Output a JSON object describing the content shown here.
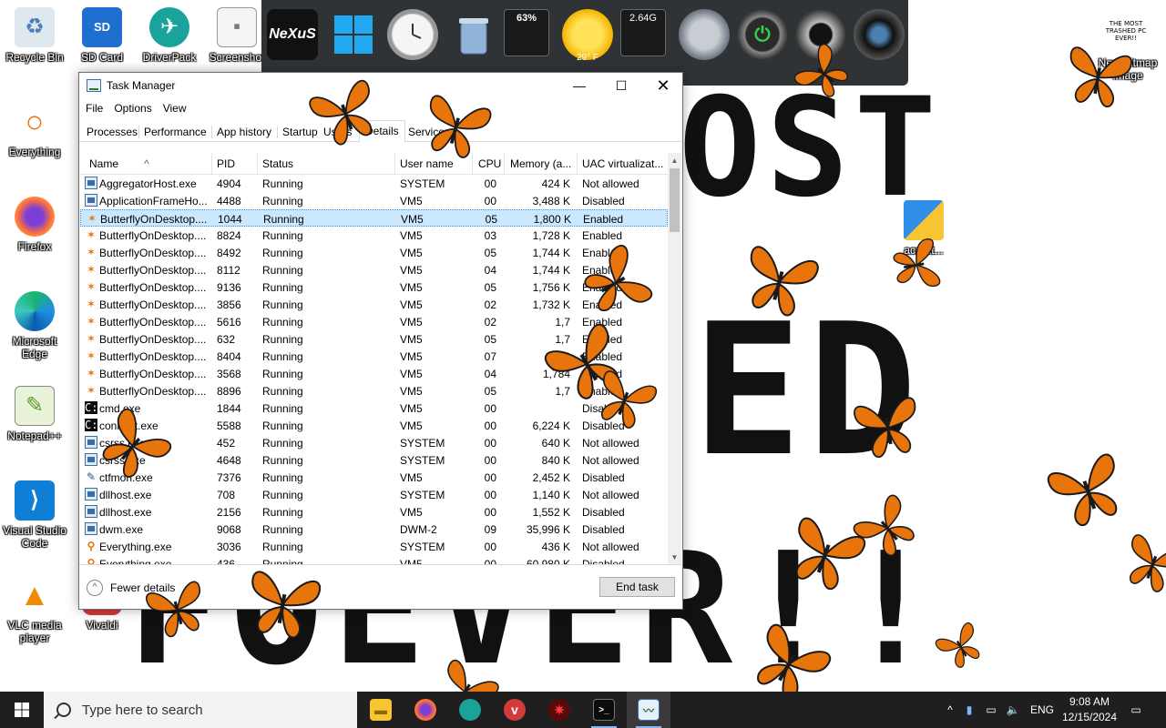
{
  "wallpaper": {
    "big_text_1": "OST",
    "big_text_2": "ED",
    "big_text_3": "FOEVER!!",
    "logo_text": "THE MOST TRASHED PC EVER!!"
  },
  "desktop_icons": [
    {
      "label": "Recycle Bin",
      "icon": "recycle-bin-icon"
    },
    {
      "label": "SD Card",
      "icon": "sd-card-icon"
    },
    {
      "label": "DriverPack",
      "icon": "driverpack-icon"
    },
    {
      "label": "Screenshot",
      "icon": "screenshot-icon"
    },
    {
      "label": "Everything",
      "icon": "everything-search-icon"
    },
    {
      "label": "Firefox",
      "icon": "firefox-icon"
    },
    {
      "label": "Microsoft Edge",
      "icon": "edge-icon"
    },
    {
      "label": "Notepad++",
      "icon": "notepadpp-icon"
    },
    {
      "label": "Visual Studio Code",
      "icon": "vscode-icon"
    },
    {
      "label": "VLC media player",
      "icon": "vlc-icon"
    },
    {
      "label": "Vivaldi",
      "icon": "vivaldi-icon"
    },
    {
      "label": "New Bitmap Image",
      "icon": "bitmap-icon"
    },
    {
      "label": "acreat...",
      "icon": "installer-shield-icon"
    }
  ],
  "dock": {
    "nexus_label": "NeXuS",
    "cpu_percent": "63%",
    "weather_temp": "29° F",
    "ram_label": "2.64G"
  },
  "taskmanager": {
    "title": "Task Manager",
    "menu": [
      "File",
      "Options",
      "View"
    ],
    "tabs": [
      "Processes",
      "Performance",
      "App history",
      "Startup",
      "Users",
      "Details",
      "Services"
    ],
    "active_tab": "Details",
    "columns": [
      "Name",
      "PID",
      "Status",
      "User name",
      "CPU",
      "Memory (a...",
      "UAC virtualizat..."
    ],
    "rows": [
      {
        "icon": "exe",
        "name": "AggregatorHost.exe",
        "pid": "4904",
        "status": "Running",
        "user": "SYSTEM",
        "cpu": "00",
        "mem": "424 K",
        "uac": "Not allowed"
      },
      {
        "icon": "exe",
        "name": "ApplicationFrameHo...",
        "pid": "4488",
        "status": "Running",
        "user": "VM5",
        "cpu": "00",
        "mem": "3,488 K",
        "uac": "Disabled"
      },
      {
        "icon": "bfly",
        "name": "ButterflyOnDesktop....",
        "pid": "1044",
        "status": "Running",
        "user": "VM5",
        "cpu": "05",
        "mem": "1,800 K",
        "uac": "Enabled",
        "selected": true
      },
      {
        "icon": "bfly",
        "name": "ButterflyOnDesktop....",
        "pid": "8824",
        "status": "Running",
        "user": "VM5",
        "cpu": "03",
        "mem": "1,728 K",
        "uac": "Enabled"
      },
      {
        "icon": "bfly",
        "name": "ButterflyOnDesktop....",
        "pid": "8492",
        "status": "Running",
        "user": "VM5",
        "cpu": "05",
        "mem": "1,744 K",
        "uac": "Enabled"
      },
      {
        "icon": "bfly",
        "name": "ButterflyOnDesktop....",
        "pid": "8112",
        "status": "Running",
        "user": "VM5",
        "cpu": "04",
        "mem": "1,744 K",
        "uac": "Enabled"
      },
      {
        "icon": "bfly",
        "name": "ButterflyOnDesktop....",
        "pid": "9136",
        "status": "Running",
        "user": "VM5",
        "cpu": "05",
        "mem": "1,756 K",
        "uac": "Enabled"
      },
      {
        "icon": "bfly",
        "name": "ButterflyOnDesktop....",
        "pid": "3856",
        "status": "Running",
        "user": "VM5",
        "cpu": "02",
        "mem": "1,732 K",
        "uac": "Enabled"
      },
      {
        "icon": "bfly",
        "name": "ButterflyOnDesktop....",
        "pid": "5616",
        "status": "Running",
        "user": "VM5",
        "cpu": "02",
        "mem": "1,7",
        "uac": "Enabled"
      },
      {
        "icon": "bfly",
        "name": "ButterflyOnDesktop....",
        "pid": "632",
        "status": "Running",
        "user": "VM5",
        "cpu": "05",
        "mem": "1,7",
        "uac": "Enabled"
      },
      {
        "icon": "bfly",
        "name": "ButterflyOnDesktop....",
        "pid": "8404",
        "status": "Running",
        "user": "VM5",
        "cpu": "07",
        "mem": "1,72",
        "uac": "Enabled"
      },
      {
        "icon": "bfly",
        "name": "ButterflyOnDesktop....",
        "pid": "3568",
        "status": "Running",
        "user": "VM5",
        "cpu": "04",
        "mem": "1,784",
        "uac": "Enabled"
      },
      {
        "icon": "bfly",
        "name": "ButterflyOnDesktop....",
        "pid": "8896",
        "status": "Running",
        "user": "VM5",
        "cpu": "05",
        "mem": "1,7",
        "uac": "Enabled"
      },
      {
        "icon": "cmd",
        "name": "cmd.exe",
        "pid": "1844",
        "status": "Running",
        "user": "VM5",
        "cpu": "00",
        "mem": "",
        "uac": "Disabled"
      },
      {
        "icon": "cmd",
        "name": "conhost.exe",
        "pid": "5588",
        "status": "Running",
        "user": "VM5",
        "cpu": "00",
        "mem": "6,224 K",
        "uac": "Disabled"
      },
      {
        "icon": "exe",
        "name": "csrss.exe",
        "pid": "452",
        "status": "Running",
        "user": "SYSTEM",
        "cpu": "00",
        "mem": "640 K",
        "uac": "Not allowed"
      },
      {
        "icon": "exe",
        "name": "csrss.exe",
        "pid": "4648",
        "status": "Running",
        "user": "SYSTEM",
        "cpu": "00",
        "mem": "840 K",
        "uac": "Not allowed"
      },
      {
        "icon": "pen",
        "name": "ctfmon.exe",
        "pid": "7376",
        "status": "Running",
        "user": "VM5",
        "cpu": "00",
        "mem": "2,452 K",
        "uac": "Disabled"
      },
      {
        "icon": "exe",
        "name": "dllhost.exe",
        "pid": "708",
        "status": "Running",
        "user": "SYSTEM",
        "cpu": "00",
        "mem": "1,140 K",
        "uac": "Not allowed"
      },
      {
        "icon": "exe",
        "name": "dllhost.exe",
        "pid": "2156",
        "status": "Running",
        "user": "VM5",
        "cpu": "00",
        "mem": "1,552 K",
        "uac": "Disabled"
      },
      {
        "icon": "exe",
        "name": "dwm.exe",
        "pid": "9068",
        "status": "Running",
        "user": "DWM-2",
        "cpu": "09",
        "mem": "35,996 K",
        "uac": "Disabled"
      },
      {
        "icon": "search",
        "name": "Everything.exe",
        "pid": "3036",
        "status": "Running",
        "user": "SYSTEM",
        "cpu": "00",
        "mem": "436 K",
        "uac": "Not allowed"
      },
      {
        "icon": "search",
        "name": "Everything.exe",
        "pid": "436",
        "status": "Running",
        "user": "VM5",
        "cpu": "00",
        "mem": "60,980 K",
        "uac": "Disabled"
      }
    ],
    "fewer_details": "Fewer details",
    "end_task": "End task"
  },
  "taskbar": {
    "search_placeholder": "Type here to search",
    "language": "ENG",
    "time": "9:08 AM",
    "date": "12/15/2024"
  },
  "colors": {
    "selection": "#cce8ff",
    "taskbar": "#1f1f1f",
    "butterfly": "#e8740c",
    "dock": "#2f3336"
  }
}
